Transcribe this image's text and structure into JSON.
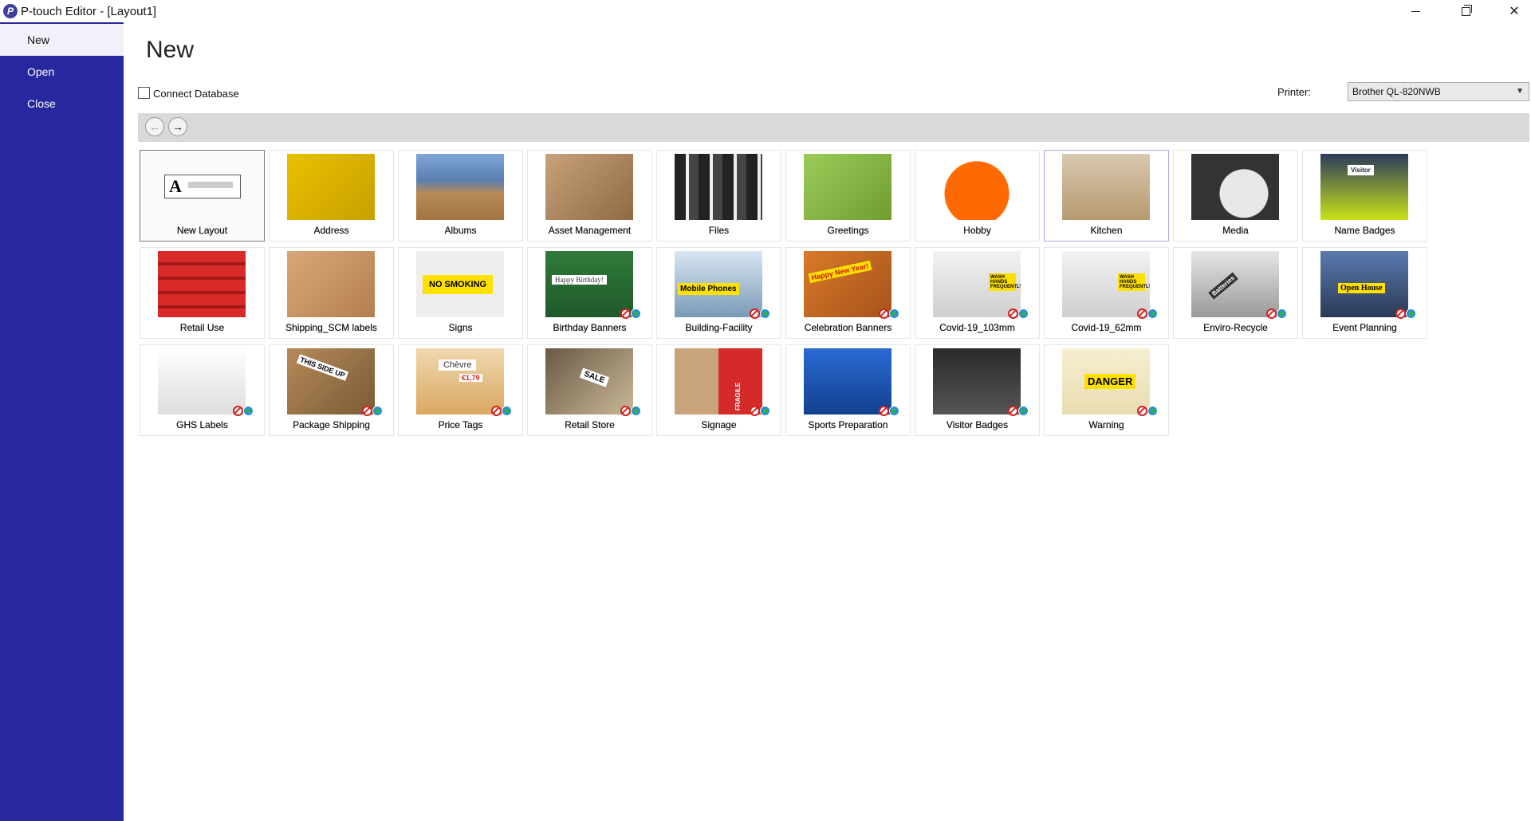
{
  "window": {
    "title": "P-touch Editor - [Layout1]",
    "logo_letter": "P"
  },
  "sidebar": {
    "items": [
      {
        "label": "New",
        "active": true
      },
      {
        "label": "Open",
        "active": false
      },
      {
        "label": "Close",
        "active": false
      }
    ]
  },
  "main": {
    "title": "New",
    "connect_database_label": "Connect Database",
    "connect_database_checked": false,
    "printer_label": "Printer:",
    "printer_value": "Brother QL-820NWB"
  },
  "templates": [
    {
      "label": "New Layout",
      "thumb": "new-layout",
      "selected": true
    },
    {
      "label": "Address",
      "thumb": "address"
    },
    {
      "label": "Albums",
      "thumb": "albums"
    },
    {
      "label": "Asset Management",
      "thumb": "asset"
    },
    {
      "label": "Files",
      "thumb": "files"
    },
    {
      "label": "Greetings",
      "thumb": "greetings"
    },
    {
      "label": "Hobby",
      "thumb": "hobby"
    },
    {
      "label": "Kitchen",
      "thumb": "kitchen",
      "hover": true
    },
    {
      "label": "Media",
      "thumb": "media"
    },
    {
      "label": "Name Badges",
      "thumb": "name-badges",
      "thumb_text": "Visitor"
    },
    {
      "label": "Retail Use",
      "thumb": "retail-use"
    },
    {
      "label": "Shipping_SCM labels",
      "thumb": "shipping"
    },
    {
      "label": "Signs",
      "thumb": "signs",
      "thumb_text": "NO SMOKING"
    },
    {
      "label": "Birthday Banners",
      "thumb": "birthday",
      "thumb_text": "Happy Birthday!",
      "badges": true
    },
    {
      "label": "Building-Facility",
      "thumb": "building",
      "thumb_text": "Mobile Phones",
      "badges": true
    },
    {
      "label": "Celebration Banners",
      "thumb": "celebration",
      "thumb_text": "Happy New Year!",
      "badges": true
    },
    {
      "label": "Covid-19_103mm",
      "thumb": "covid103",
      "thumb_text": "WASH HANDS FREQUENTLY",
      "badges": true
    },
    {
      "label": "Covid-19_62mm",
      "thumb": "covid62",
      "thumb_text": "WASH HANDS FREQUENTLY",
      "badges": true
    },
    {
      "label": "Enviro-Recycle",
      "thumb": "enviro",
      "thumb_text": "Batteries",
      "badges": true
    },
    {
      "label": "Event Planning",
      "thumb": "event",
      "thumb_text": "Open House",
      "badges": true
    },
    {
      "label": "GHS Labels",
      "thumb": "ghs",
      "badges": true
    },
    {
      "label": "Package Shipping",
      "thumb": "package",
      "thumb_text": "THIS SIDE UP",
      "badges": true
    },
    {
      "label": "Price Tags",
      "thumb": "price",
      "thumb_text": "Chèvre",
      "thumb_text2": "€1,79",
      "badges": true
    },
    {
      "label": "Retail Store",
      "thumb": "retail-store",
      "thumb_text": "SALE",
      "badges": true
    },
    {
      "label": "Signage",
      "thumb": "signage",
      "thumb_text": "FRAGILE",
      "badges": true
    },
    {
      "label": "Sports Preparation",
      "thumb": "sports",
      "badges": true
    },
    {
      "label": "Visitor Badges",
      "thumb": "visitor",
      "badges": true
    },
    {
      "label": "Warning",
      "thumb": "warning",
      "thumb_text": "DANGER",
      "badges": true
    }
  ],
  "colors": {
    "sidebar_bg": "#27279e",
    "nav_bar_bg": "#d9d9d9"
  }
}
